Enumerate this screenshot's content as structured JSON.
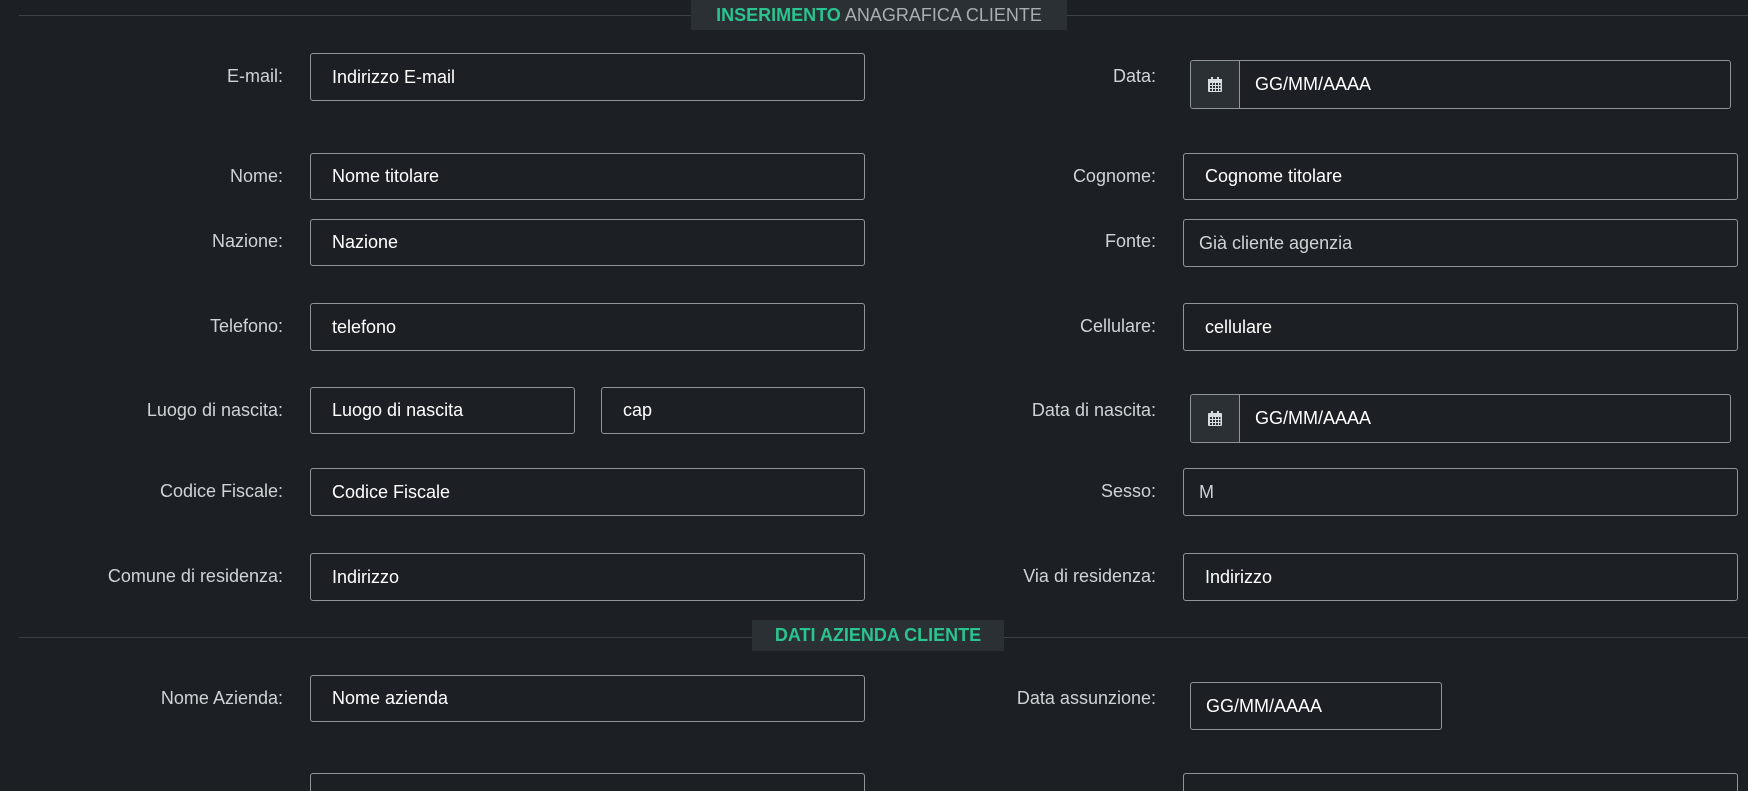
{
  "section_anagrafica": {
    "title_accent": "INSERIMENTO",
    "title_rest": "ANAGRAFICA CLIENTE"
  },
  "section_azienda": {
    "title": "DATI AZIENDA CLIENTE"
  },
  "fields": {
    "email": {
      "label": "E-mail:",
      "value": "Indirizzo E-mail"
    },
    "data": {
      "label": "Data:",
      "value": "GG/MM/AAAA",
      "icon": "calendar-icon"
    },
    "nome": {
      "label": "Nome:",
      "value": "Nome titolare"
    },
    "cognome": {
      "label": "Cognome:",
      "value": "Cognome titolare"
    },
    "nazione": {
      "label": "Nazione:",
      "value": "Nazione"
    },
    "fonte": {
      "label": "Fonte:",
      "value": "Già cliente agenzia"
    },
    "telefono": {
      "label": "Telefono:",
      "value": "telefono"
    },
    "cellulare": {
      "label": "Cellulare:",
      "value": "cellulare"
    },
    "luogo_nascita": {
      "label": "Luogo di nascita:",
      "value": "Luogo di nascita",
      "cap": "cap"
    },
    "data_nascita": {
      "label": "Data di nascita:",
      "value": "GG/MM/AAAA",
      "icon": "calendar-icon"
    },
    "codice_fiscale": {
      "label": "Codice Fiscale:",
      "value": "Codice Fiscale"
    },
    "sesso": {
      "label": "Sesso:",
      "value": "M"
    },
    "comune_residenza": {
      "label": "Comune di residenza:",
      "value": "Indirizzo"
    },
    "via_residenza": {
      "label": "Via di residenza:",
      "value": "Indirizzo"
    },
    "nome_azienda": {
      "label": "Nome Azienda:",
      "value": "Nome azienda"
    },
    "data_assunzione": {
      "label": "Data assunzione:",
      "value": "GG/MM/AAAA"
    }
  },
  "colors": {
    "background": "#1c2024",
    "accent": "#29c48f",
    "border": "#8f959b",
    "label": "#cfd3d6"
  }
}
